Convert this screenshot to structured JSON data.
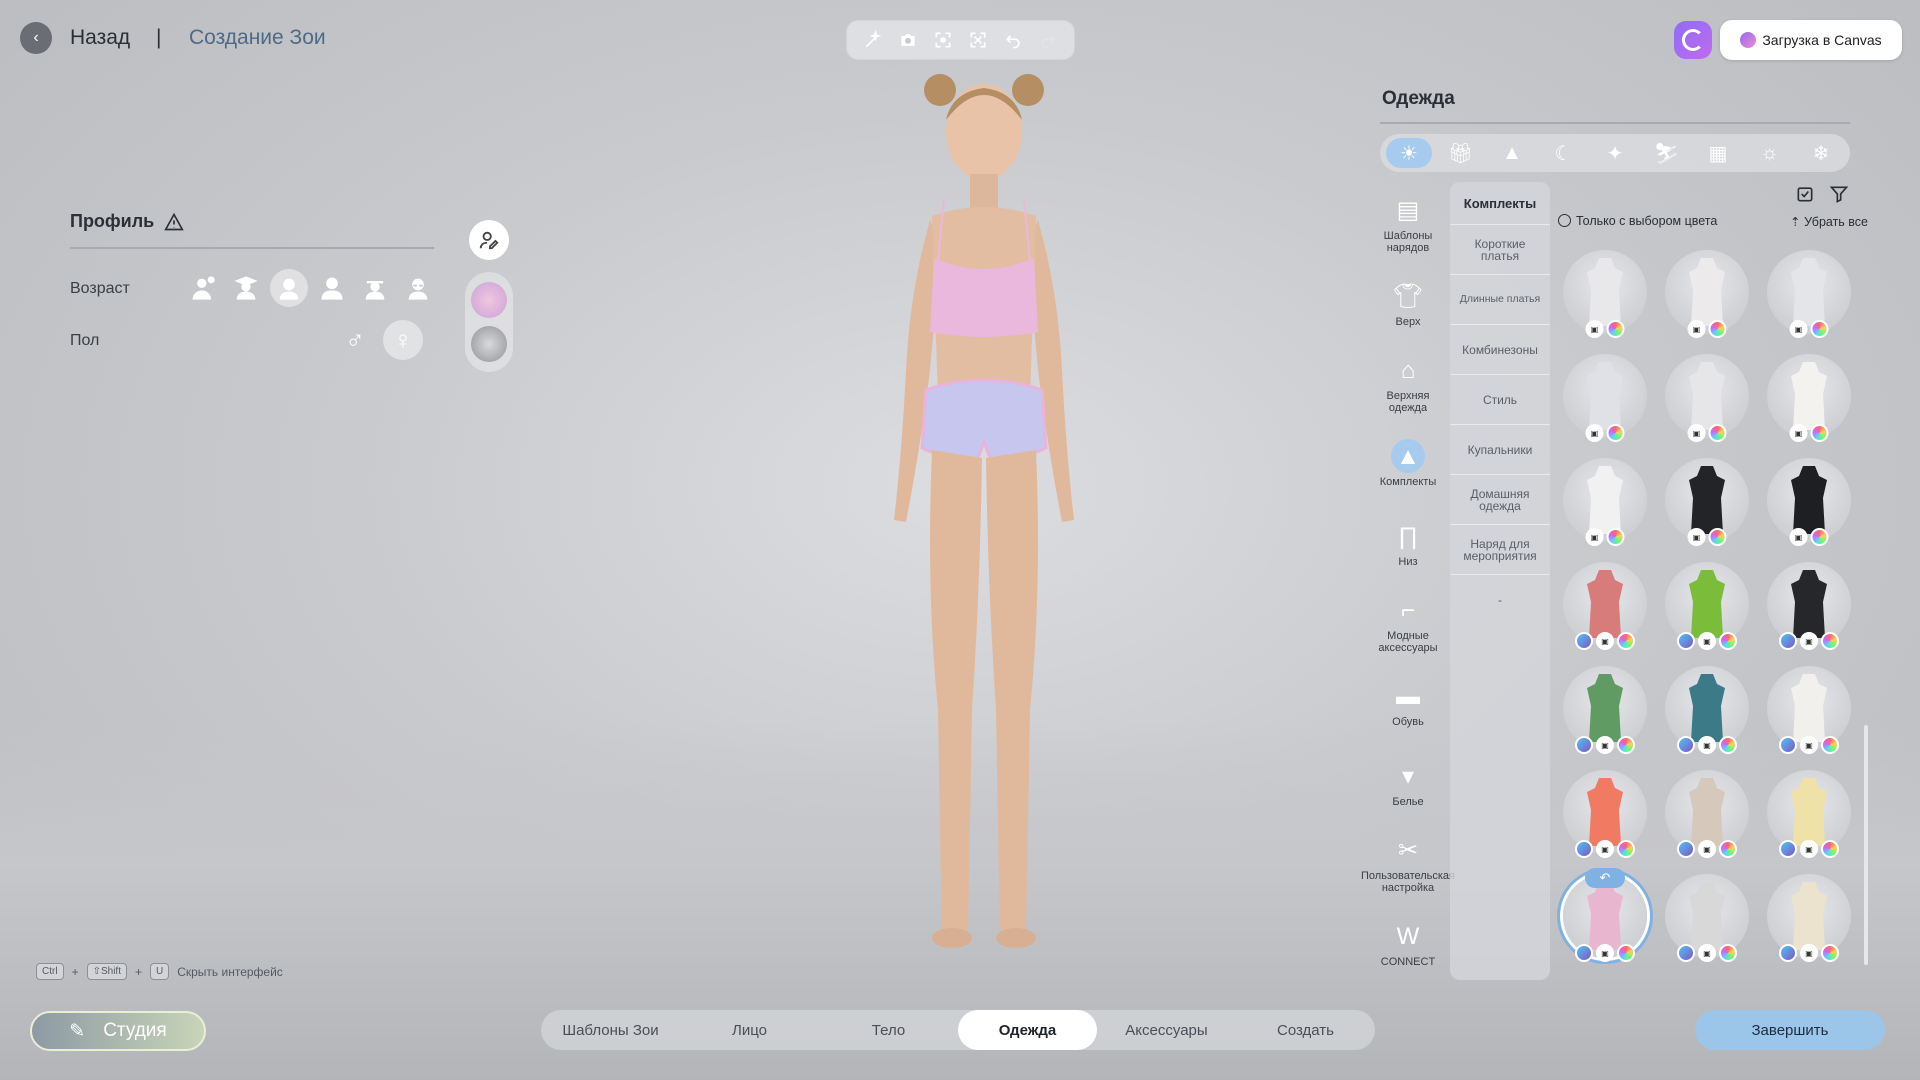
{
  "header": {
    "back_label": "Назад",
    "separator": "|",
    "title": "Создание Зои"
  },
  "toolbar": {
    "icons": [
      "magic-wand-icon",
      "camera-icon",
      "frame-icon",
      "focus-icon",
      "undo-icon",
      "redo-icon"
    ]
  },
  "canvas": {
    "upload_label": "Загрузка в Canvas"
  },
  "profile": {
    "title": "Профиль",
    "age_label": "Возраст",
    "gender_label": "Пол",
    "age_options_count": 6,
    "selected_age_index": 2,
    "selected_gender": "female"
  },
  "shortcut": {
    "keys": [
      "Ctrl",
      "⇧Shift",
      "U"
    ],
    "plus": "+",
    "label": "Скрыть интерфейс"
  },
  "studio": {
    "label": "Студия"
  },
  "bottom_nav": {
    "tabs": [
      "Шаблоны Зои",
      "Лицо",
      "Тело",
      "Одежда",
      "Аксессуары",
      "Создать"
    ],
    "active": "Одежда"
  },
  "finish_label": "Завершить",
  "clothing": {
    "title": "Одежда",
    "categories": [
      {
        "label": "Шаблоны нарядов",
        "icon": "outfit-template-icon"
      },
      {
        "label": "Верх",
        "icon": "tshirt-icon"
      },
      {
        "label": "Верхняя одежда",
        "icon": "jacket-icon"
      },
      {
        "label": "Комплекты",
        "icon": "dress-icon"
      },
      {
        "label": "Низ",
        "icon": "pants-icon"
      },
      {
        "label": "Модные аксессуары",
        "icon": "sock-icon"
      },
      {
        "label": "Обувь",
        "icon": "shoe-icon"
      },
      {
        "label": "Белье",
        "icon": "underwear-icon"
      },
      {
        "label": "Пользовательская настройка",
        "icon": "scissors-icon"
      },
      {
        "label": "CONNECT",
        "icon": "connect-icon"
      }
    ],
    "active_category": "Комплекты",
    "subcategory_title": "Комплекты",
    "subcategories": [
      "Короткие платья",
      "Длинные платья",
      "Комбинезоны",
      "Стиль",
      "Купальники",
      "Домашняя одежда",
      "Наряд для мероприятия",
      "-"
    ],
    "filter_color_label": "Только с выбором цвета",
    "remove_all_label": "Убрать все",
    "items": [
      {
        "name": "pajama-set-1",
        "color": "#e8e8ea",
        "ai": false
      },
      {
        "name": "pajama-set-2",
        "color": "#eceaea",
        "ai": false
      },
      {
        "name": "pajama-set-3",
        "color": "#e4e5e8",
        "ai": false
      },
      {
        "name": "pajama-set-4",
        "color": "#dfe1e6",
        "ai": false
      },
      {
        "name": "pajama-set-5",
        "color": "#e6e6e8",
        "ai": false
      },
      {
        "name": "wedding-dress",
        "color": "#f3f2ee",
        "ai": false
      },
      {
        "name": "white-mini-dress",
        "color": "#f1f1f1",
        "ai": false
      },
      {
        "name": "black-tuxedo-1",
        "color": "#222428",
        "ai": false
      },
      {
        "name": "black-tuxedo-2",
        "color": "#1d1f23",
        "ai": false
      },
      {
        "name": "pink-red-dress",
        "color": "#d77b7b",
        "ai": true
      },
      {
        "name": "green-floral-set",
        "color": "#7bbd3a",
        "ai": true
      },
      {
        "name": "black-puff-dress",
        "color": "#26272b",
        "ai": true
      },
      {
        "name": "green-slip-dress",
        "color": "#5f9b63",
        "ai": true
      },
      {
        "name": "teal-robe",
        "color": "#3b7a86",
        "ai": true
      },
      {
        "name": "white-gown",
        "color": "#f2f0ec",
        "ai": true
      },
      {
        "name": "coral-dress",
        "color": "#f07a62",
        "ai": true
      },
      {
        "name": "beige-lace-dress",
        "color": "#d6c8bb",
        "ai": true
      },
      {
        "name": "yellow-slip-dress",
        "color": "#efe2a8",
        "ai": true
      },
      {
        "name": "pink-crop-set",
        "color": "#e8b7cf",
        "ai": true
      },
      {
        "name": "grey-casual-set",
        "color": "#d8d8d8",
        "ai": true
      },
      {
        "name": "cream-jumpsuit",
        "color": "#ece3cf",
        "ai": true
      }
    ],
    "selected_index": 18
  },
  "colors": {
    "accent": "#a7cbef",
    "finish_button": "#9cc5ea",
    "title_blue": "#4d6a86"
  }
}
